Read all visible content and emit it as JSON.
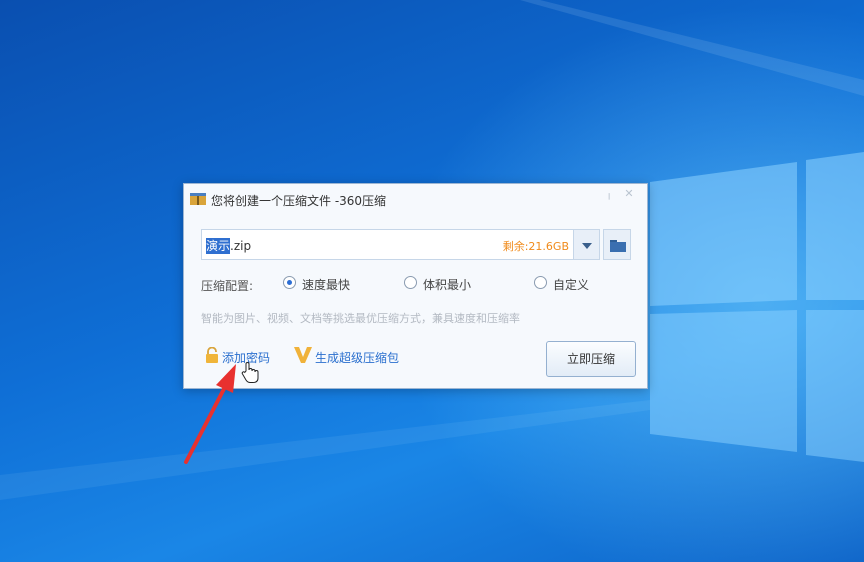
{
  "dialog": {
    "title": "您将创建一个压缩文件 -360压缩",
    "filename_selected": "演示",
    "filename_rest": ".zip",
    "free_space": "剩余:21.6GB",
    "config_label": "压缩配置:",
    "options": [
      {
        "label": "速度最快",
        "checked": true
      },
      {
        "label": "体积最小",
        "checked": false
      },
      {
        "label": "自定义",
        "checked": false
      }
    ],
    "hint": "智能为图片、视频、文档等挑选最优压缩方式，兼具速度和压缩率",
    "add_password": "添加密码",
    "super_pack": "生成超级压缩包",
    "compress_now": "立即压缩"
  },
  "colors": {
    "accent": "#2a6fce",
    "free_space": "#f08a1a",
    "selection": "#2f6fd0",
    "arrow": "#e8312f"
  },
  "icons": [
    "archive-icon",
    "close-icon",
    "chevron-down-icon",
    "folder-icon",
    "lock-icon",
    "v-icon",
    "hand-cursor-icon",
    "red-arrow"
  ]
}
